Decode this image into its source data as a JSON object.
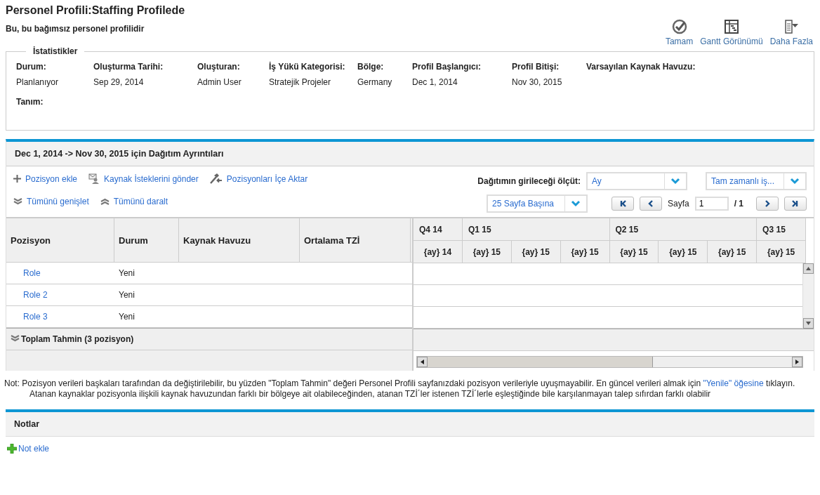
{
  "header": {
    "title": "Personel Profili:Staffing Profilede",
    "subtitle": "Bu, bu bağımsız personel profilidir",
    "actions": [
      {
        "kind": "check",
        "label": "Tamam"
      },
      {
        "kind": "gantt",
        "label": "Gantt Görünümü"
      },
      {
        "kind": "more",
        "label": "Daha Fazla"
      }
    ]
  },
  "statistics": {
    "legend": "İstatistikler",
    "fields": [
      {
        "label": "Durum:",
        "value": "Planlanıyor"
      },
      {
        "label": "Oluşturma Tarihi:",
        "value": "Sep 29, 2014"
      },
      {
        "label": "Oluşturan:",
        "value": "Admin User"
      },
      {
        "label": "İş Yükü Kategorisi:",
        "value": "Stratejik Projeler"
      },
      {
        "label": "Bölge:",
        "value": "Germany"
      },
      {
        "label": "Profil Başlangıcı:",
        "value": "Dec 1, 2014"
      },
      {
        "label": "Profil Bitişi:",
        "value": "Nov 30, 2015"
      },
      {
        "label": "Varsayılan Kaynak Havuzu:"
      }
    ],
    "description_label": "Tanım:"
  },
  "allocation": {
    "title": "Dec 1, 2014 -> Nov 30, 2015 için Dağıtım Ayrıntıları",
    "actions": [
      {
        "kind": "add",
        "label": "Pozisyon ekle"
      },
      {
        "kind": "send",
        "label": "Kaynak İsteklerini gönder"
      },
      {
        "kind": "import",
        "label": "Pozisyonları İçe Aktar"
      }
    ],
    "tree_actions": [
      {
        "kind": "expand",
        "label": "Tümünü genişlet"
      },
      {
        "kind": "collapse",
        "label": "Tümünü daralt"
      }
    ],
    "measure": {
      "label": "Dağıtımın girileceği ölçüt:",
      "value": "Ay"
    },
    "unit_select": {
      "value": "Tam zamanlı iş..."
    },
    "page_size": {
      "value": "25 Sayfa Başına"
    },
    "pager": {
      "label": "Sayfa",
      "page": "1",
      "total": "/ 1"
    },
    "columns": [
      "Pozisyon",
      "Durum",
      "Kaynak Havuzu",
      "Ortalama TZİ"
    ],
    "rows": [
      {
        "position": "Role",
        "status": "Yeni"
      },
      {
        "position": "Role 2",
        "status": "Yeni"
      },
      {
        "position": "Role 3",
        "status": "Yeni"
      }
    ],
    "summary": "Toplam Tahmin (3 pozisyon)",
    "quarters": [
      {
        "label": "Q4 14",
        "months": [
          "{ay} 14"
        ]
      },
      {
        "label": "Q1 15",
        "months": [
          "{ay} 15",
          "{ay} 15",
          "{ay} 15"
        ]
      },
      {
        "label": "Q2 15",
        "months": [
          "{ay} 15",
          "{ay} 15",
          "{ay} 15"
        ]
      },
      {
        "label": "Q3 15",
        "months": [
          "{ay} 15"
        ]
      }
    ]
  },
  "note": {
    "before": "Not: Pozisyon verileri başkaları tarafından da değiştirilebilir, bu yüzden \"Toplam Tahmin\" değeri Personel Profili sayfanızdaki pozisyon verileriyle uyuşmayabilir. En güncel verileri almak için ",
    "link": "\"Yenile\" öğesine",
    "after": " tıklayın.",
    "detail": "Atanan kaynaklar pozisyonla ilişkili kaynak havuzundan farklı bir bölgeye ait olabileceğinden, atanan TZİ´ler istenen TZİ´lerle eşleştiğinde bile karşılanmayan talep sıfırdan farklı olabilir"
  },
  "notes_panel": {
    "title": "Notlar",
    "add_label": "Not ekle"
  }
}
